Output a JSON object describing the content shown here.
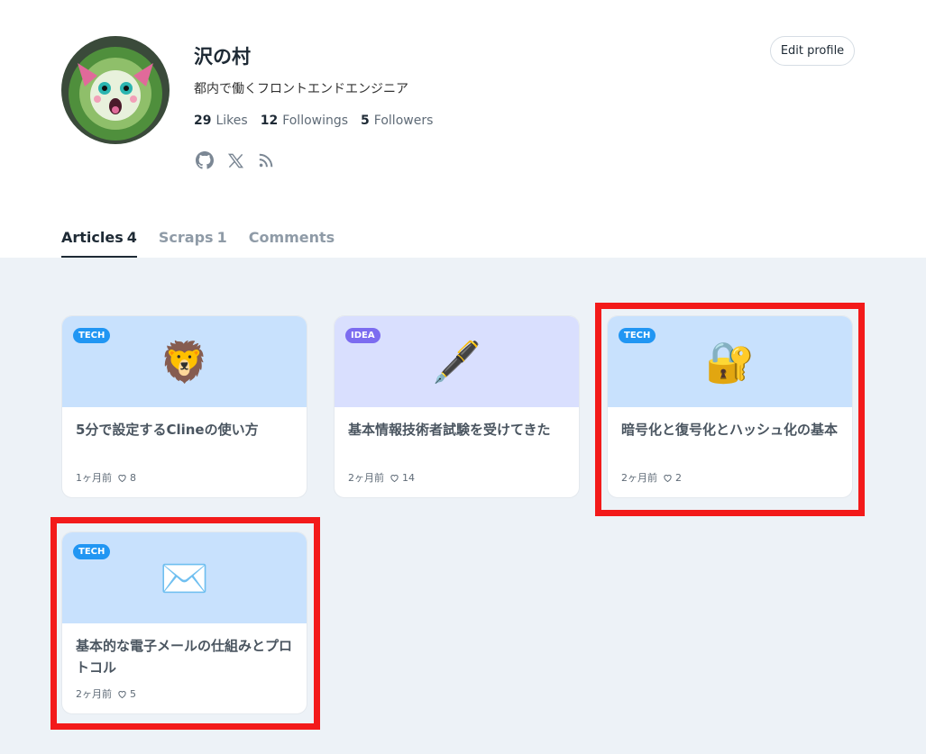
{
  "profile": {
    "name": "沢の村",
    "bio": "都内で働くフロントエンドエンジニア",
    "stats": [
      {
        "count": "29",
        "label": "Likes"
      },
      {
        "count": "12",
        "label": "Followings"
      },
      {
        "count": "5",
        "label": "Followers"
      }
    ],
    "socials": [
      "github-icon",
      "x-icon",
      "rss-icon"
    ],
    "edit_label": "Edit profile"
  },
  "tabs": [
    {
      "label": "Articles",
      "count": "4",
      "active": true
    },
    {
      "label": "Scraps",
      "count": "1",
      "active": false
    },
    {
      "label": "Comments",
      "count": "",
      "active": false
    }
  ],
  "articles": [
    {
      "tag": "TECH",
      "emoji": "🦁",
      "title": "5分で設定するClineの使い方",
      "date": "1ヶ月前",
      "likes": "8",
      "bg": "#c8e1fd",
      "tag_color": "#2196f3"
    },
    {
      "tag": "IDEA",
      "emoji": "🖋️",
      "title": "基本情報技術者試験を受けてきた",
      "date": "2ヶ月前",
      "likes": "14",
      "bg": "#d9dffe",
      "tag_color": "#7c6cf0"
    },
    {
      "tag": "TECH",
      "emoji": "🔐",
      "title": "暗号化と復号化とハッシュ化の基本",
      "date": "2ヶ月前",
      "likes": "2",
      "bg": "#c8e1fd",
      "tag_color": "#2196f3"
    },
    {
      "tag": "TECH",
      "emoji": "✉️",
      "title": "基本的な電子メールの仕組みとプロトコル",
      "date": "2ヶ月前",
      "likes": "5",
      "bg": "#c8e1fd",
      "tag_color": "#2196f3"
    }
  ],
  "colors": {
    "highlight": "#f31a1a",
    "content_bg": "#edf2f7"
  }
}
